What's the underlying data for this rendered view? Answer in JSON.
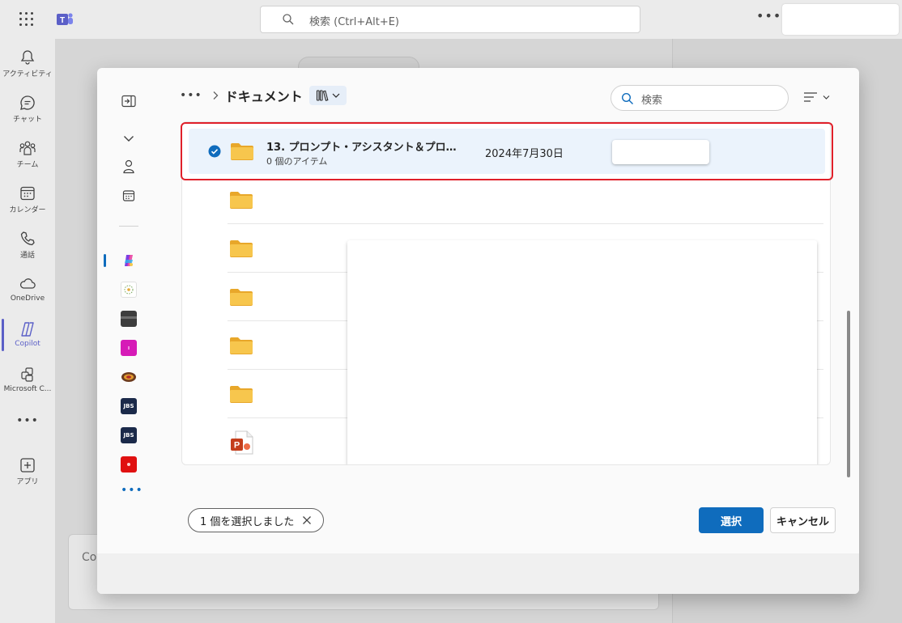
{
  "topbar": {
    "search_placeholder": "検索 (Ctrl+Alt+E)",
    "more_label": "•••"
  },
  "rail": {
    "items": [
      {
        "label": "アクティビティ",
        "icon": "bell-icon"
      },
      {
        "label": "チャット",
        "icon": "chat-icon"
      },
      {
        "label": "チーム",
        "icon": "teams-icon"
      },
      {
        "label": "カレンダー",
        "icon": "calendar-icon"
      },
      {
        "label": "通話",
        "icon": "phone-icon"
      },
      {
        "label": "OneDrive",
        "icon": "cloud-icon"
      },
      {
        "label": "Copilot",
        "icon": "copilot-icon"
      },
      {
        "label": "Microsoft C...",
        "icon": "apps-icon"
      },
      {
        "label": "アプリ",
        "icon": "add-app-icon"
      }
    ],
    "more_label": "•••"
  },
  "background": {
    "compose_text": "Co"
  },
  "dialog": {
    "breadcrumb_more": "•••",
    "breadcrumb_title": "ドキュメント",
    "search_placeholder": "検索",
    "side_apps": [
      {
        "label": "JBS",
        "color": "#1b2a4a"
      },
      {
        "label": "JBS",
        "color": "#1b2a4a"
      }
    ],
    "side_more": "•••",
    "selected_item": {
      "name": "13. プロンプト・アシスタント＆プロ…",
      "subtitle": "0 個のアイテム",
      "date": "2024年7月30日"
    },
    "selection_count": "1 個を選択しました",
    "select_button": "選択",
    "cancel_button": "キャンセル"
  },
  "colors": {
    "accent": "#0f6cbd",
    "teams_purple": "#5b5fc7",
    "highlight_outline": "#e0202a",
    "folder": "#f4c44f"
  }
}
